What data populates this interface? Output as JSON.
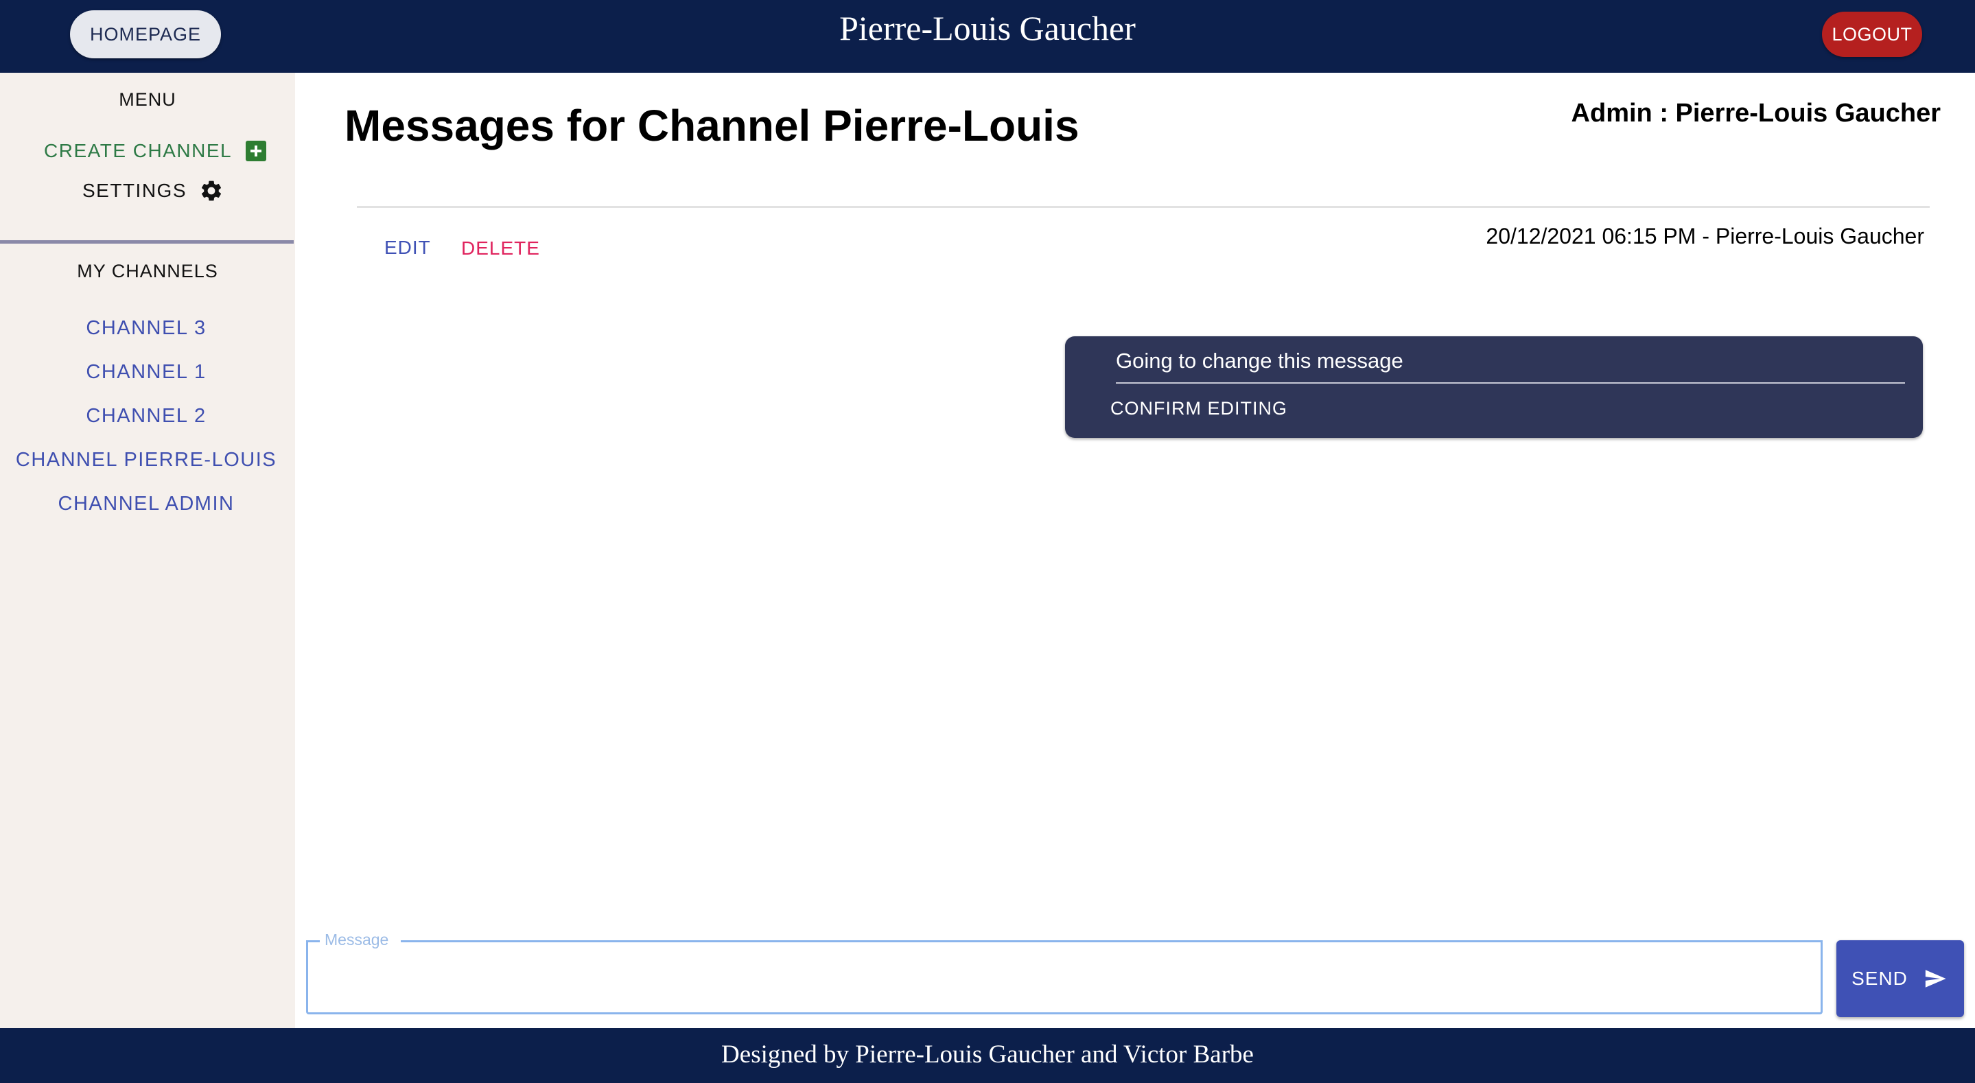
{
  "header": {
    "home_label": "HOMEPAGE",
    "site_title": "Pierre-Louis Gaucher",
    "logout_label": "LOGOUT"
  },
  "sidebar": {
    "menu_title": "MENU",
    "create_channel_label": "CREATE CHANNEL",
    "settings_label": "SETTINGS",
    "my_channels_title": "MY CHANNELS",
    "channels": [
      {
        "label": "CHANNEL 3"
      },
      {
        "label": "CHANNEL 1"
      },
      {
        "label": "CHANNEL 2"
      },
      {
        "label": "CHANNEL PIERRE-LOUIS"
      },
      {
        "label": "CHANNEL ADMIN"
      }
    ]
  },
  "main": {
    "title": "Messages for Channel Pierre-Louis",
    "admin_label": "Admin : Pierre-Louis Gaucher",
    "message": {
      "edit_label": "EDIT",
      "delete_label": "DELETE",
      "meta": "20/12/2021 06:15 PM - Pierre-Louis Gaucher",
      "edit_value": "Going to change this message",
      "confirm_label": "CONFIRM EDITING"
    },
    "composer": {
      "label": "Message",
      "value": "",
      "send_label": "SEND"
    }
  },
  "footer": {
    "text": "Designed by Pierre-Louis Gaucher and Victor Barbe"
  },
  "colors": {
    "header_bg": "#0c1f4b",
    "logout_bg": "#b5201f",
    "sidebar_bg": "#f5f0ec",
    "link_blue": "#3f51b5",
    "create_green": "#2e7a46",
    "delete_pink": "#e0245e",
    "bubble_bg": "#2f3658"
  },
  "icons": [
    "plus-box-icon",
    "gear-icon",
    "send-icon"
  ]
}
